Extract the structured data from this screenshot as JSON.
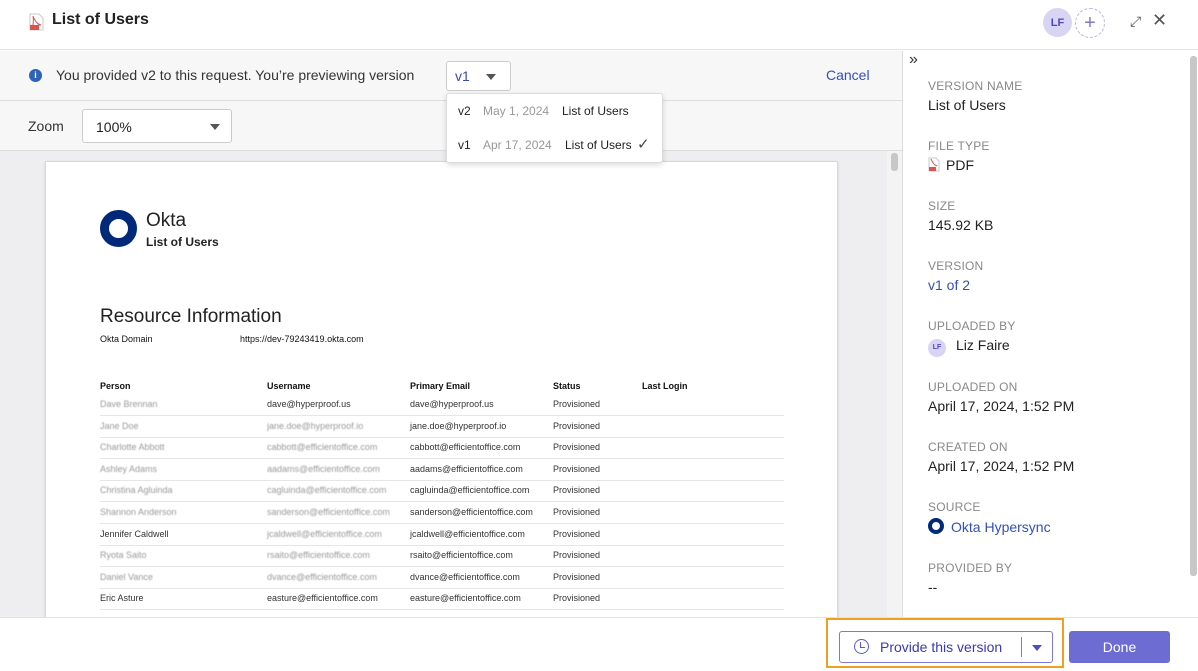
{
  "header": {
    "title": "List of Users",
    "avatar_initials": "LF",
    "add_label": "+",
    "expand_label": "⤢",
    "close_label": "✕"
  },
  "notice": {
    "info_glyph": "i",
    "text": "You provided v2 to this request. You’re previewing version",
    "selected_version": "v1",
    "cancel_label": "Cancel"
  },
  "zoom": {
    "label": "Zoom",
    "value": "100%"
  },
  "version_dropdown": [
    {
      "version": "v2",
      "date": "May 1, 2024",
      "name": "List of Users",
      "selected": false
    },
    {
      "version": "v1",
      "date": "Apr 17, 2024",
      "name": "List of Users",
      "selected": true
    }
  ],
  "document": {
    "brand": "Okta",
    "title": "List of Users",
    "section_heading": "Resource Information",
    "domain_label": "Okta Domain",
    "domain_value": "https://dev-79243419.okta.com",
    "columns": [
      "Person",
      "Username",
      "Primary Email",
      "Status",
      "Last Login"
    ],
    "rows": [
      [
        "Dave Brennan",
        "dave@hyperproof.us",
        "dave@hyperproof.us",
        "Provisioned",
        ""
      ],
      [
        "Jane Doe",
        "jane.doe@hyperproof.io",
        "jane.doe@hyperproof.io",
        "Provisioned",
        ""
      ],
      [
        "Charlotte Abbott",
        "cabbott@efficientoffice.com",
        "cabbott@efficientoffice.com",
        "Provisioned",
        ""
      ],
      [
        "Ashley Adams",
        "aadams@efficientoffice.com",
        "aadams@efficientoffice.com",
        "Provisioned",
        ""
      ],
      [
        "Christina Agluinda",
        "cagluinda@efficientoffice.com",
        "cagluinda@efficientoffice.com",
        "Provisioned",
        ""
      ],
      [
        "Shannon Anderson",
        "sanderson@efficientoffice.com",
        "sanderson@efficientoffice.com",
        "Provisioned",
        ""
      ],
      [
        "Jennifer Caldwell",
        "jcaldwell@efficientoffice.com",
        "jcaldwell@efficientoffice.com",
        "Provisioned",
        ""
      ],
      [
        "Ryota Saito",
        "rsaito@efficientoffice.com",
        "rsaito@efficientoffice.com",
        "Provisioned",
        ""
      ],
      [
        "Daniel Vance",
        "dvance@efficientoffice.com",
        "dvance@efficientoffice.com",
        "Provisioned",
        ""
      ],
      [
        "Eric Asture",
        "easture@efficientoffice.com",
        "easture@efficientoffice.com",
        "Provisioned",
        ""
      ]
    ]
  },
  "sidebar": {
    "collapse_label": "»",
    "version_name_label": "VERSION NAME",
    "version_name": "List of Users",
    "file_type_label": "FILE TYPE",
    "file_type": "PDF",
    "size_label": "SIZE",
    "size": "145.92 KB",
    "version_label": "VERSION",
    "version": "v1 of 2",
    "uploaded_by_label": "UPLOADED BY",
    "uploaded_by_initials": "LF",
    "uploaded_by": "Liz Faire",
    "uploaded_on_label": "UPLOADED ON",
    "uploaded_on": "April 17, 2024, 1:52 PM",
    "created_on_label": "CREATED ON",
    "created_on": "April 17, 2024, 1:52 PM",
    "source_label": "SOURCE",
    "source": "Okta Hypersync",
    "provided_by_label": "PROVIDED BY",
    "provided_by": "--"
  },
  "footer": {
    "provide_label": "Provide this version",
    "done_label": "Done"
  }
}
